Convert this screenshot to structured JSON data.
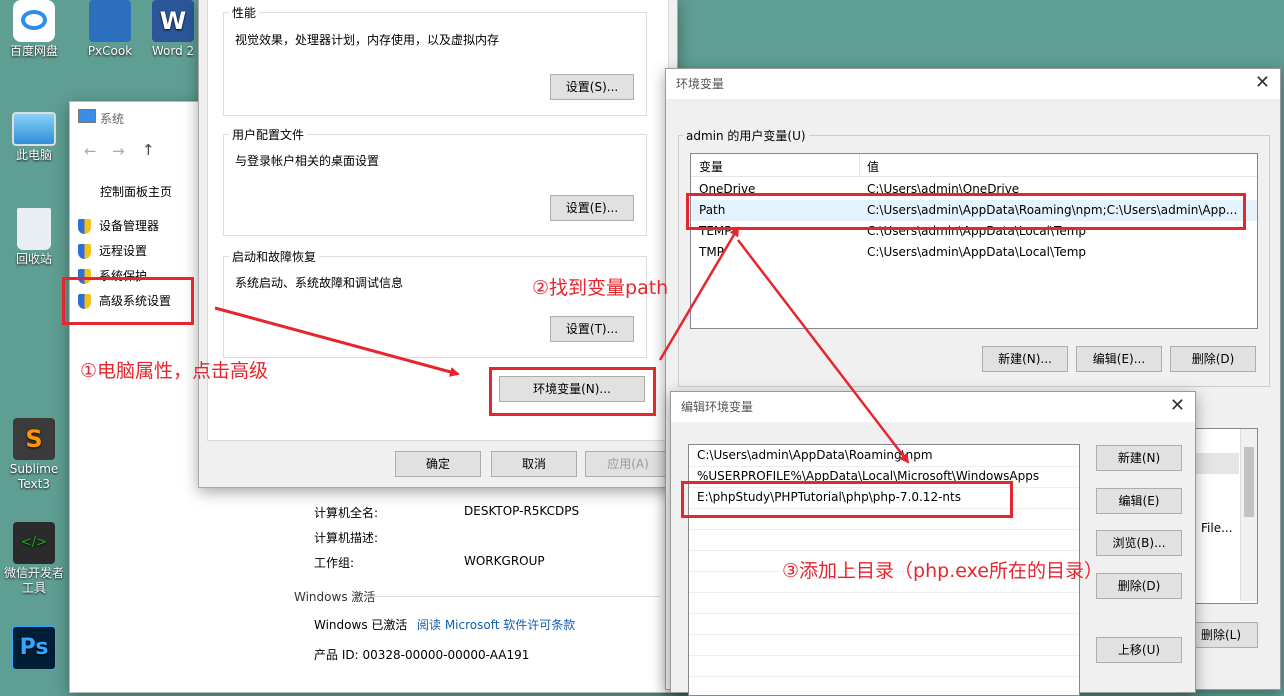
{
  "desktop": {
    "icons": [
      {
        "label": "百度网盘",
        "icon": "baidu-netdisk-icon"
      },
      {
        "label": "PxCook",
        "icon": "pxcook-icon"
      },
      {
        "label": "Word 2",
        "icon": "word-icon"
      },
      {
        "label": "此电脑",
        "icon": "computer-icon"
      },
      {
        "label": "回收站",
        "icon": "recycle-bin-icon"
      },
      {
        "label": "Sublime Text3",
        "icon": "sublime-icon"
      },
      {
        "label": "微信开发者工具",
        "icon": "wechat-devtools-icon"
      },
      {
        "label": "Ps",
        "icon": "photoshop-icon"
      }
    ]
  },
  "system_window": {
    "title": "系统",
    "sidebar_home": "控制面板主页",
    "links": [
      "设备管理器",
      "远程设置",
      "系统保护",
      "高级系统设置"
    ],
    "info": [
      {
        "label": "计算机全名:",
        "value": "DESKTOP-R5KCDPS"
      },
      {
        "label": "计算机描述:",
        "value": ""
      },
      {
        "label": "工作组:",
        "value": "WORKGROUP"
      }
    ],
    "activation_header": "Windows 激活",
    "activation_status": "Windows 已激活",
    "activation_link": "阅读 Microsoft 软件许可条款",
    "product_id": "产品 ID: 00328-00000-00000-AA191"
  },
  "sysprops": {
    "perf": {
      "title": "性能",
      "desc": "视觉效果，处理器计划，内存使用，以及虚拟内存",
      "button": "设置(S)..."
    },
    "profile": {
      "title": "用户配置文件",
      "desc": "与登录帐户相关的桌面设置",
      "button": "设置(E)..."
    },
    "startup": {
      "title": "启动和故障恢复",
      "desc": "系统启动、系统故障和调试信息",
      "button": "设置(T)..."
    },
    "env_button": "环境变量(N)...",
    "ok": "确定",
    "cancel": "取消",
    "apply": "应用(A)"
  },
  "env_window": {
    "title": "环境变量",
    "user_group": "admin 的用户变量(U)",
    "col_var": "变量",
    "col_val": "值",
    "rows": [
      {
        "name": "OneDrive",
        "value": "C:\\Users\\admin\\OneDrive"
      },
      {
        "name": "Path",
        "value": "C:\\Users\\admin\\AppData\\Roaming\\npm;C:\\Users\\admin\\App..."
      },
      {
        "name": "TEMP",
        "value": "C:\\Users\\admin\\AppData\\Local\\Temp"
      },
      {
        "name": "TMP",
        "value": "C:\\Users\\admin\\AppData\\Local\\Temp"
      }
    ],
    "new": "新建(N)...",
    "edit": "编辑(E)...",
    "delete": "删除(D)",
    "partial_text": "File...",
    "partial_delete": "删除(L)"
  },
  "edit_window": {
    "title": "编辑环境变量",
    "entries": [
      "C:\\Users\\admin\\AppData\\Roaming\\npm",
      "%USERPROFILE%\\AppData\\Local\\Microsoft\\WindowsApps",
      "E:\\phpStudy\\PHPTutorial\\php\\php-7.0.12-nts"
    ],
    "new": "新建(N)",
    "edit": "编辑(E)",
    "browse": "浏览(B)...",
    "delete": "删除(D)",
    "up": "上移(U)"
  },
  "annotations": {
    "step1": "①电脑属性，点击高级",
    "step2": "②找到变量path",
    "step3": "③添加上目录（php.exe所在的目录）"
  },
  "colors": {
    "annotation": "#e5262e",
    "desktop": "#5f9e93",
    "link": "#0f5eb0"
  }
}
